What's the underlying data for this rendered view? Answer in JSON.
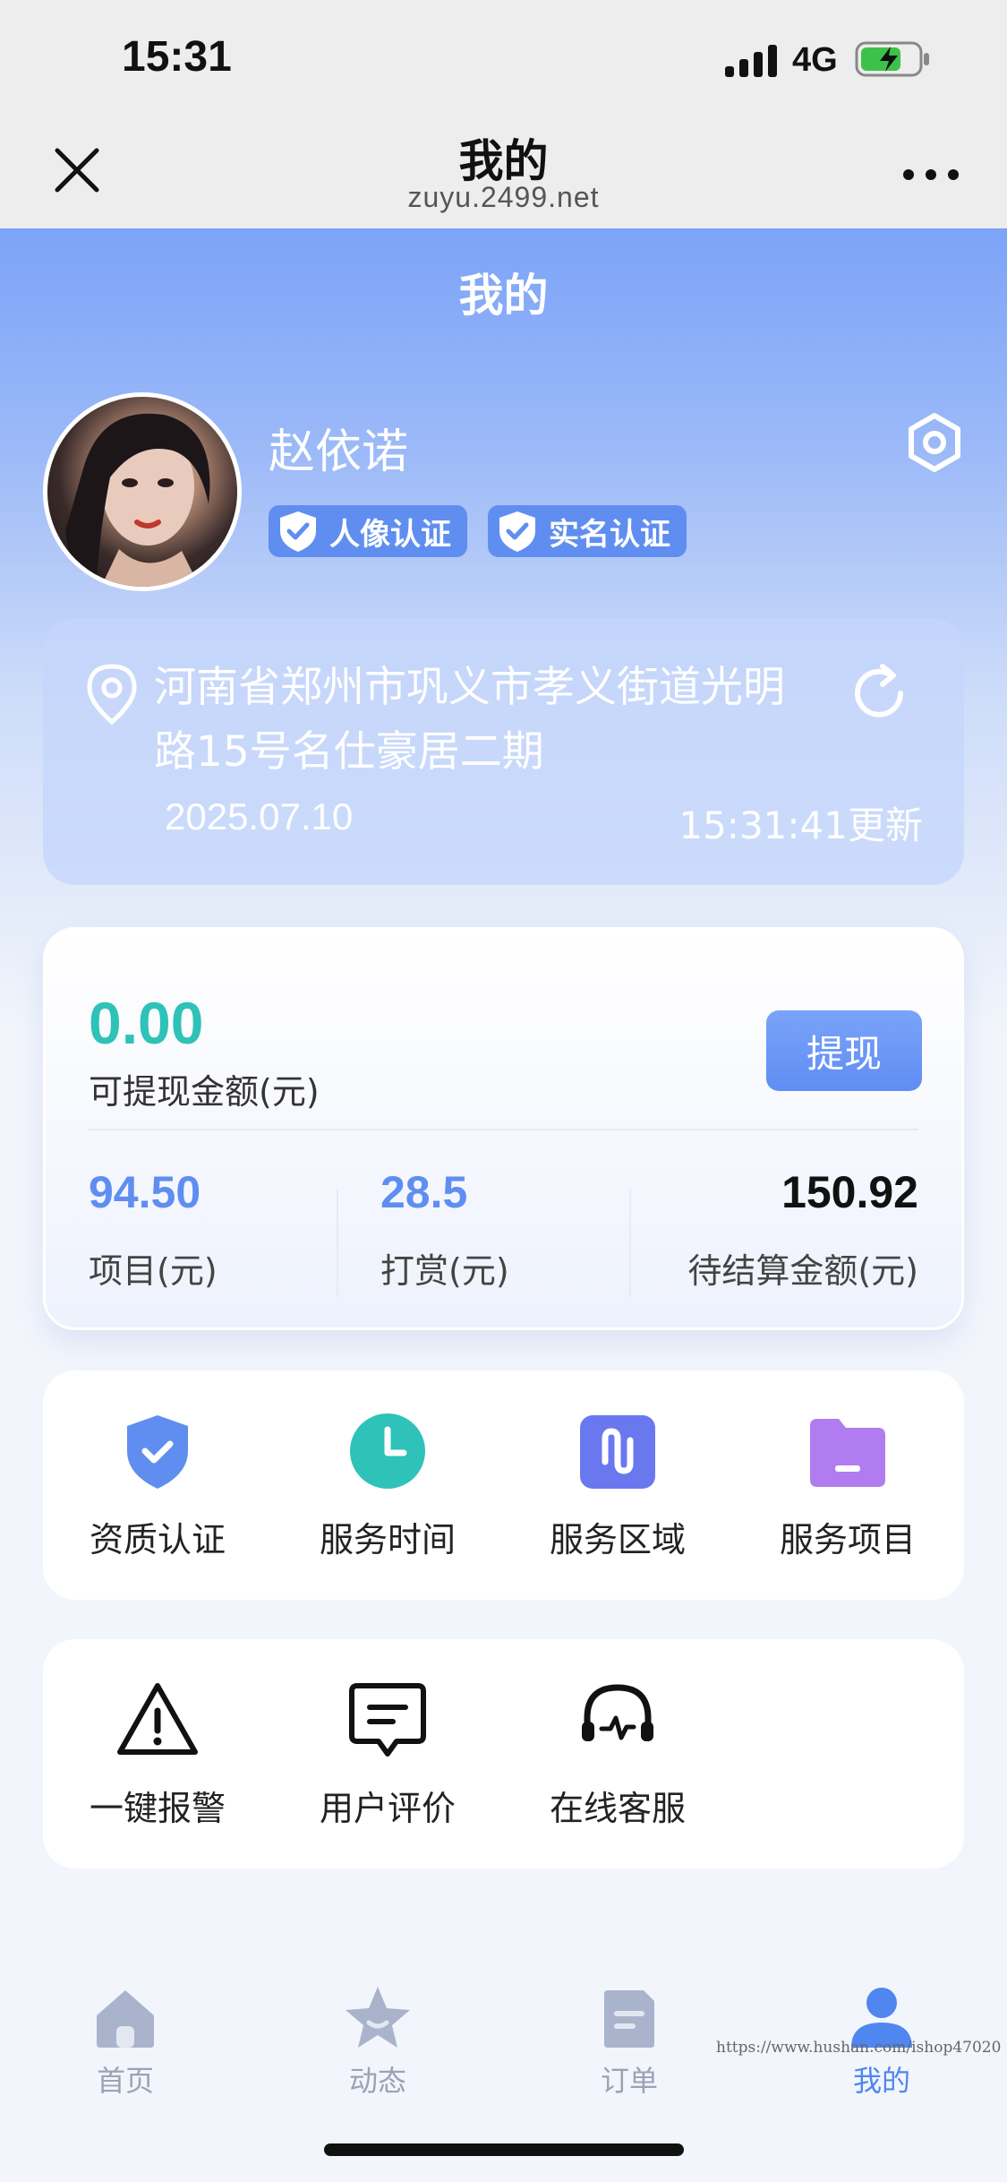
{
  "status_bar": {
    "time": "15:31",
    "network": "4G"
  },
  "nav_bar": {
    "title": "我的",
    "url": "zuyu.2499.net"
  },
  "page_title": "我的",
  "profile": {
    "name": "赵依诺",
    "badges": [
      "人像认证",
      "实名认证"
    ]
  },
  "location": {
    "address": "河南省郑州市巩义市孝义街道光明路15号名仕豪居二期",
    "date": "2025.07.10",
    "updated": "15:31:41更新"
  },
  "wallet": {
    "withdrawable_value": "0.00",
    "withdrawable_label": "可提现金额(元)",
    "withdraw_button": "提现",
    "stats": [
      {
        "value": "94.50",
        "label": "项目(元)"
      },
      {
        "value": "28.5",
        "label": "打赏(元)"
      },
      {
        "value": "150.92",
        "label": "待结算金额(元)"
      }
    ]
  },
  "services": [
    {
      "label": "资质认证",
      "icon": "shield-check-icon",
      "color": "#5f8ef0"
    },
    {
      "label": "服务时间",
      "icon": "clock-icon",
      "color": "#2ec2b8"
    },
    {
      "label": "服务区域",
      "icon": "map-area-icon",
      "color": "#6a78f0"
    },
    {
      "label": "服务项目",
      "icon": "folder-icon",
      "color": "#b07cf0"
    }
  ],
  "tools": [
    {
      "label": "一键报警",
      "icon": "warning-icon"
    },
    {
      "label": "用户评价",
      "icon": "chat-icon"
    },
    {
      "label": "在线客服",
      "icon": "headset-icon"
    }
  ],
  "tabbar": {
    "items": [
      {
        "label": "首页",
        "icon": "home-icon"
      },
      {
        "label": "动态",
        "icon": "star-icon"
      },
      {
        "label": "订单",
        "icon": "order-icon"
      },
      {
        "label": "我的",
        "icon": "user-icon",
        "active": true
      }
    ]
  },
  "watermark": "https://www.hushan.com/ishop47020",
  "colors": {
    "accent": "#5f8ef0",
    "teal": "#2ec2b8",
    "active_tab": "#4f86f0"
  }
}
